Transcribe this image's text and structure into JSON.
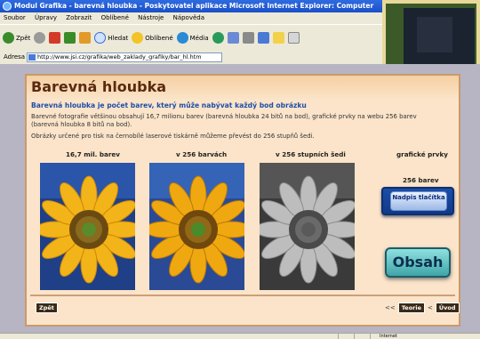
{
  "window": {
    "title": "Modul Grafika - barevná hloubka - Poskytovatel aplikace Microsoft Internet Explorer: Computer"
  },
  "menu": [
    "Soubor",
    "Úpravy",
    "Zobrazit",
    "Oblíbené",
    "Nástroje",
    "Nápověda"
  ],
  "toolbar": {
    "back": "Zpět",
    "search": "Hledat",
    "favorites": "Oblíbené",
    "media": "Média"
  },
  "address": {
    "label": "Adresa",
    "url": "http://www.jsi.cz/grafika/web_zaklady_grafiky/bar_hl.htm"
  },
  "page": {
    "title": "Barevná hloubka",
    "lead": "Barevná hloubka je počet barev, který může nabývat každý bod obrázku",
    "para1": "Barevné fotografie většinou obsahují 16,7 milionu barev (barevná hloubka 24 bitů na bod), grafické prvky na webu 256 barev (barevná hloubka 8 bitů na bod).",
    "para2": "Obrázky určené pro tisk na černobílé laserové tiskárně můžeme převést do 256 stupňů šedi.",
    "columns": [
      "16,7 mil. barev",
      "v 256 barvách",
      "v 256 stupních šedi",
      "grafické prvky"
    ],
    "palette_label": "256 barev",
    "nadpis_button": "Nadpis tlačítka",
    "obsah_button": "Obsah",
    "back_button": "Zpět",
    "nav_prefix": "<<",
    "nav_theory": "Teorie",
    "nav_sep": "<",
    "nav_intro": "Úvod"
  },
  "status": {
    "zone": "Internet"
  },
  "colors": {
    "title_brown": "#5a2a10",
    "lead_blue": "#1e4ea8",
    "panel_bg": "#fbe4c9"
  }
}
